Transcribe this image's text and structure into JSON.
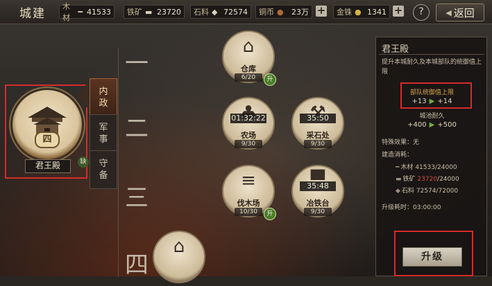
{
  "header": {
    "title": "城建",
    "resources": [
      {
        "label": "木材",
        "icon": "wood-icon",
        "value": "41533"
      },
      {
        "label": "铁矿",
        "icon": "iron-icon",
        "value": "23720"
      },
      {
        "label": "石料",
        "icon": "stone-icon",
        "value": "72574"
      },
      {
        "label": "铜币",
        "icon": "copper-icon",
        "value": "23万"
      },
      {
        "label": "金铢",
        "icon": "gold-icon",
        "value": "1341"
      }
    ],
    "help_label": "?",
    "back_label": "返回"
  },
  "lord_hall": {
    "name": "君王殿",
    "level_badge": "四",
    "tag": "缺"
  },
  "tabs": [
    {
      "label_1": "内",
      "label_2": "政",
      "active": true
    },
    {
      "label_1": "军",
      "label_2": "事",
      "active": false
    },
    {
      "label_1": "守",
      "label_2": "备",
      "active": false
    }
  ],
  "rows": [
    "一",
    "二",
    "三",
    "四"
  ],
  "buildings": [
    {
      "name": "仓库",
      "level": "6/20",
      "timer": "",
      "upgrade": "升"
    },
    {
      "name": "农场",
      "level": "9/30",
      "timer": "01:32:22",
      "upgrade": ""
    },
    {
      "name": "采石处",
      "level": "9/30",
      "timer": "35:50",
      "upgrade": ""
    },
    {
      "name": "伐木场",
      "level": "10/30",
      "timer": "",
      "upgrade": "升"
    },
    {
      "name": "冶铁台",
      "level": "9/30",
      "timer": "35:48",
      "upgrade": ""
    }
  ],
  "detail": {
    "title": "君王殿",
    "description": "提升本城耐久及本城部队的统御值上限",
    "stat1_title": "部队统御值上限",
    "stat1_from": "+13",
    "stat1_to": "+14",
    "stat2_title": "城池耐久",
    "stat2_from": "+400",
    "stat2_to": "+500",
    "special_label": "特殊效果：无",
    "cost_label": "建造消耗：",
    "costs": [
      {
        "label": "木材",
        "have": "41533",
        "need": "/24000",
        "short": false
      },
      {
        "label": "铁矿",
        "have": "23720",
        "need": "/24000",
        "short": true
      },
      {
        "label": "石料",
        "have": "72574",
        "need": "/72000",
        "short": false
      }
    ],
    "time_label": "升级耗时：03:00:00",
    "upgrade_button": "升级"
  }
}
